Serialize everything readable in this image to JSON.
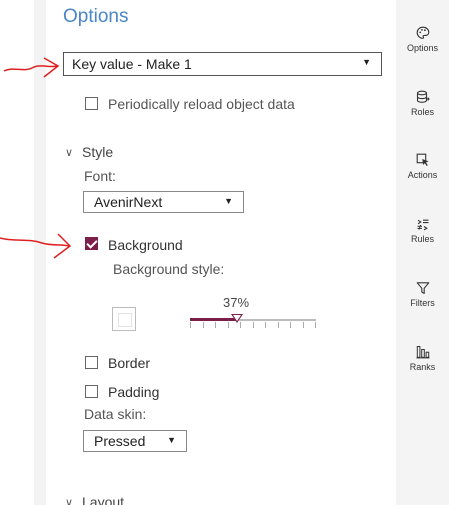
{
  "panel": {
    "title": "Options",
    "object_select": "Key value - Make 1",
    "reload_label": "Periodically reload object data",
    "reload_checked": false
  },
  "style_section": {
    "label": "Style",
    "font_label": "Font:",
    "font_value": "AvenirNext",
    "background_label": "Background",
    "background_checked": true,
    "background_style_label": "Background style:",
    "transparency_value": "37%",
    "transparency_fraction": 0.37,
    "border_label": "Border",
    "border_checked": false,
    "padding_label": "Padding",
    "padding_checked": false,
    "data_skin_label": "Data skin:",
    "data_skin_value": "Pressed"
  },
  "layout_section": {
    "label": "Layout"
  },
  "rail": {
    "items": [
      {
        "label": "Options",
        "icon": "palette-icon"
      },
      {
        "label": "Roles",
        "icon": "database-icon"
      },
      {
        "label": "Actions",
        "icon": "cursor-icon"
      },
      {
        "label": "Rules",
        "icon": "rules-icon"
      },
      {
        "label": "Filters",
        "icon": "filter-icon"
      },
      {
        "label": "Ranks",
        "icon": "ranks-icon"
      }
    ]
  },
  "colors": {
    "accent": "#7b1f4a",
    "title_blue": "#4a86c8",
    "annotation_red": "#e02020"
  }
}
